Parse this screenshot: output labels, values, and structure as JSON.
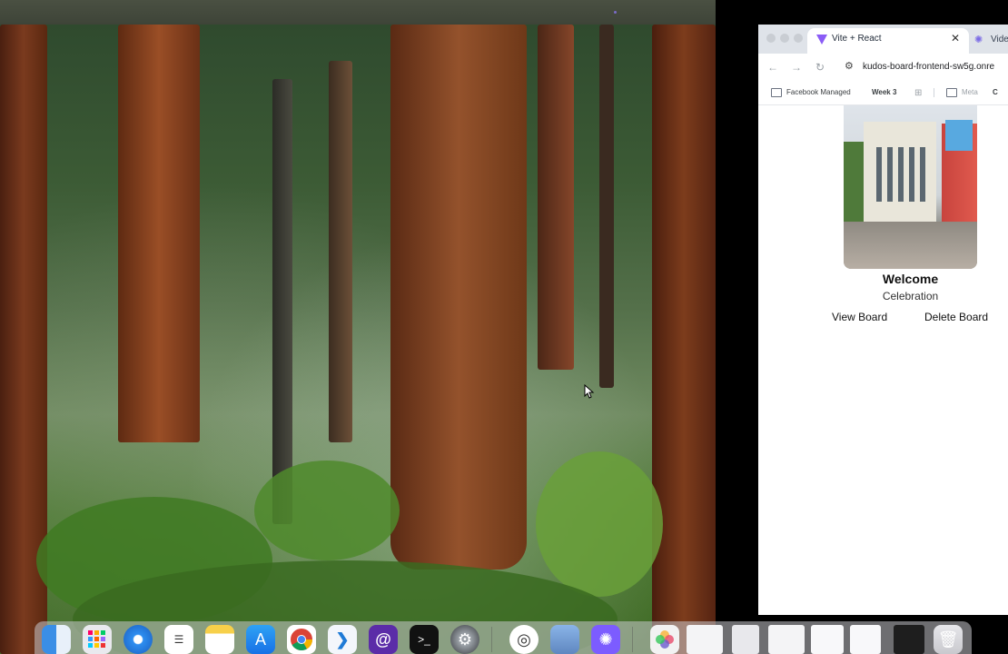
{
  "browser": {
    "tabs": [
      {
        "title": "Vite + React",
        "close": "✕"
      },
      {
        "title": "Video"
      }
    ],
    "nav": {
      "back": "←",
      "forward": "→",
      "reload": "↻",
      "site_settings": "⚙"
    },
    "url": "kudos-board-frontend-sw5g.onre",
    "bookmarks": [
      {
        "label": "Facebook Managed"
      },
      {
        "label": "Week 3"
      },
      {
        "label": "Meta"
      }
    ]
  },
  "board_card": {
    "title": "Welcome",
    "category": "Celebration",
    "view_label": "View Board",
    "delete_label": "Delete Board"
  },
  "dock": {
    "apps": [
      {
        "icon": "finder-icon"
      },
      {
        "icon": "launchpad-icon"
      },
      {
        "icon": "safari-icon"
      },
      {
        "icon": "reminders-icon"
      },
      {
        "icon": "notes-icon"
      },
      {
        "icon": "app-store-icon"
      },
      {
        "icon": "chrome-icon"
      },
      {
        "icon": "vscode-icon"
      },
      {
        "icon": "workplace-chat-icon"
      },
      {
        "icon": "terminal-icon"
      },
      {
        "icon": "system-settings-icon"
      },
      {
        "icon": "activity-icon"
      },
      {
        "icon": "preview-icon"
      },
      {
        "icon": "self-service-icon"
      },
      {
        "icon": "photos-icon"
      },
      {
        "icon": "window-thumbnail-icon"
      },
      {
        "icon": "trash-icon"
      }
    ]
  },
  "colors": {
    "accent": "#8b5cf6",
    "tab_bar": "#dfe3e9"
  }
}
